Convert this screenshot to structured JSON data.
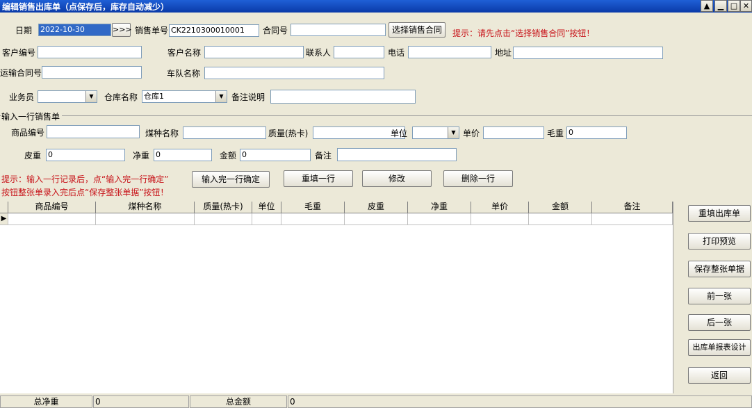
{
  "window": {
    "title": "编辑销售出库单（点保存后，库存自动减少）"
  },
  "header": {
    "date_label": "日期",
    "date_value": "2022-10-30",
    "date_picker_label": ">>>",
    "order_no_label": "销售单号",
    "order_no_value": "CK2210300010001",
    "contract_no_label": "合同号",
    "contract_no_value": "",
    "select_contract_label": "选择销售合同",
    "hint": "提示：请先点击“选择销售合同”按钮！"
  },
  "customer": {
    "code_label": "客户编号",
    "code_value": "",
    "name_label": "客户名称",
    "name_value": "",
    "contact_label": "联系人",
    "contact_value": "",
    "phone_label": "电话",
    "phone_value": "",
    "address_label": "地址",
    "address_value": ""
  },
  "transport": {
    "contract_label": "运输合同号",
    "contract_value": "",
    "fleet_label": "车队名称",
    "fleet_value": ""
  },
  "misc": {
    "salesman_label": "业务员",
    "salesman_value": "",
    "warehouse_label": "仓库名称",
    "warehouse_value": "仓库1",
    "remark_label": "备注说明",
    "remark_value": ""
  },
  "line_entry": {
    "section_label": "输入一行销售单",
    "product_code_label": "商品编号",
    "product_code_value": "",
    "coal_name_label": "煤种名称",
    "coal_name_value": "",
    "quality_label": "质量(热卡)",
    "quality_value": "",
    "unit_label": "单位",
    "unit_value": "",
    "price_label": "单价",
    "price_value": "",
    "gross_label": "毛重",
    "gross_value": "0",
    "tare_label": "皮重",
    "tare_value": "0",
    "net_label": "净重",
    "net_value": "0",
    "amount_label": "金额",
    "amount_value": "0",
    "note_label": "备注",
    "note_value": ""
  },
  "hints": {
    "line1": "提示：输入一行记录后，点“输入完一行确定”",
    "line2": "按钮整张单录入完后点“保存整张单据”按钮！"
  },
  "row_actions": {
    "confirm_label": "输入完一行确定",
    "refill_label": "重填一行",
    "modify_label": "修改",
    "delete_label": "删除一行"
  },
  "grid": {
    "columns": [
      "商品编号",
      "煤种名称",
      "质量(热卡)",
      "单位",
      "毛重",
      "皮重",
      "净重",
      "单价",
      "金额",
      "备注"
    ],
    "row_indicator": "▶"
  },
  "side_buttons": {
    "refill_order": "重填出库单",
    "print_preview": "打印预览",
    "save_all": "保存整张单据",
    "prev": "前一张",
    "next": "后一张",
    "report_design": "出库单报表设计",
    "back": "返回"
  },
  "statusbar": {
    "total_net_label": "总净重",
    "total_net_value": "0",
    "total_amount_label": "总金额",
    "total_amount_value": "0"
  },
  "window_controls": {
    "restore": "▲",
    "minimize": "▁",
    "maximize": "□",
    "close": "✕"
  },
  "colors": {
    "title_bar": "#0a3aa8",
    "hint_red": "#c8141a",
    "selection_blue": "#3169c6",
    "window_bg": "#ece9d8"
  }
}
